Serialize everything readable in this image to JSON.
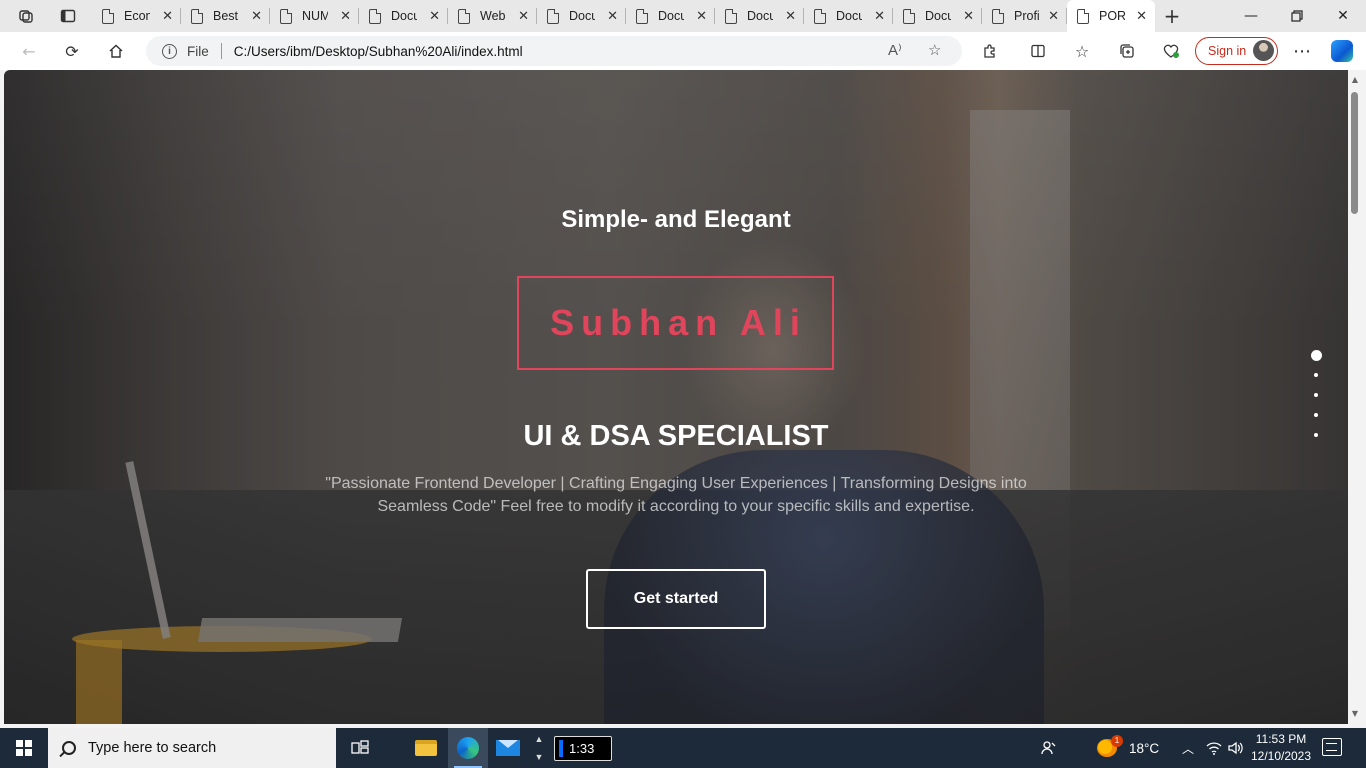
{
  "browser": {
    "tabs": [
      {
        "title": "Economics"
      },
      {
        "title": "Best"
      },
      {
        "title": "NUM"
      },
      {
        "title": "Document"
      },
      {
        "title": "Web"
      },
      {
        "title": "Document"
      },
      {
        "title": "Document"
      },
      {
        "title": "Document"
      },
      {
        "title": "Document"
      },
      {
        "title": "Document"
      },
      {
        "title": "Profile"
      },
      {
        "title": "PORTFOLIO",
        "active": true
      }
    ],
    "address": {
      "scheme": "File",
      "url": "C:/Users/ibm/Desktop/Subhan%20Ali/index.html"
    },
    "signin_label": "Sign in",
    "accent_color": "#c42b1c"
  },
  "hero": {
    "tagline": "Simple- and Elegant",
    "name": "Subhan Ali",
    "role": "UI & DSA SPECIALIST",
    "description": "\"Passionate Frontend Developer | Crafting Engaging User Experiences | Transforming Designs into Seamless Code\" Feel free to modify it according to your specific skills and expertise.",
    "cta_label": "Get started",
    "name_color": "#e0455c",
    "dots": {
      "count": 5,
      "active_index": 0
    }
  },
  "taskbar": {
    "search_placeholder": "Type here to search",
    "timer": "1:33",
    "weather": {
      "temp": "18°C",
      "badge": "1"
    },
    "clock": {
      "time": "11:53 PM",
      "date": "12/10/2023"
    }
  }
}
